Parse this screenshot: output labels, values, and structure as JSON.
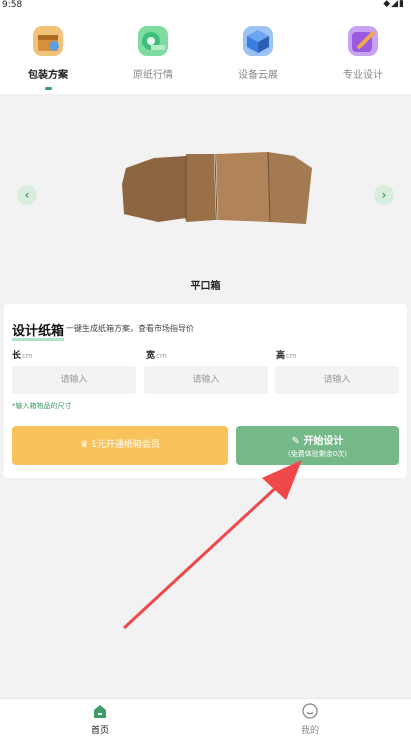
{
  "status_bar": {
    "time": "9:58",
    "icons": "◆◢▮"
  },
  "top_tabs": [
    {
      "label": "包装方案",
      "icon": "package-icon",
      "color": "#e0a24a",
      "active": true
    },
    {
      "label": "原纸行情",
      "icon": "paper-roll-icon",
      "color": "#3fbf7a",
      "active": false
    },
    {
      "label": "设备云展",
      "icon": "cube-icon",
      "color": "#3b7de0",
      "active": false
    },
    {
      "label": "专业设计",
      "icon": "brush-icon",
      "color": "#9a5be0",
      "active": false
    }
  ],
  "preview": {
    "box_name": "平口箱",
    "prev_arrow": "‹",
    "next_arrow": "›",
    "box_color": "#a37a52"
  },
  "design_card": {
    "title": "设计纸箱",
    "subtitle": "一键生成纸箱方案，查看市场指导价",
    "dims": [
      {
        "label": "长",
        "unit": "cm",
        "placeholder": "请输入"
      },
      {
        "label": "宽",
        "unit": "cm",
        "placeholder": "请输入"
      },
      {
        "label": "高",
        "unit": "cm",
        "placeholder": "请输入"
      }
    ],
    "hint": "*输入箱物品的尺寸",
    "vip_button": "1元开通纸箱会员",
    "design_button": "开始设计",
    "design_sub": "(免费体验剩余0次)"
  },
  "bottom_nav": [
    {
      "label": "首页",
      "icon": "home-icon",
      "active": true
    },
    {
      "label": "我的",
      "icon": "smiley-icon",
      "active": false
    }
  ],
  "colors": {
    "accent": "#3d9b64",
    "vip": "#f9c35c",
    "design": "#76b988",
    "annotation_arrow": "#f04848"
  }
}
